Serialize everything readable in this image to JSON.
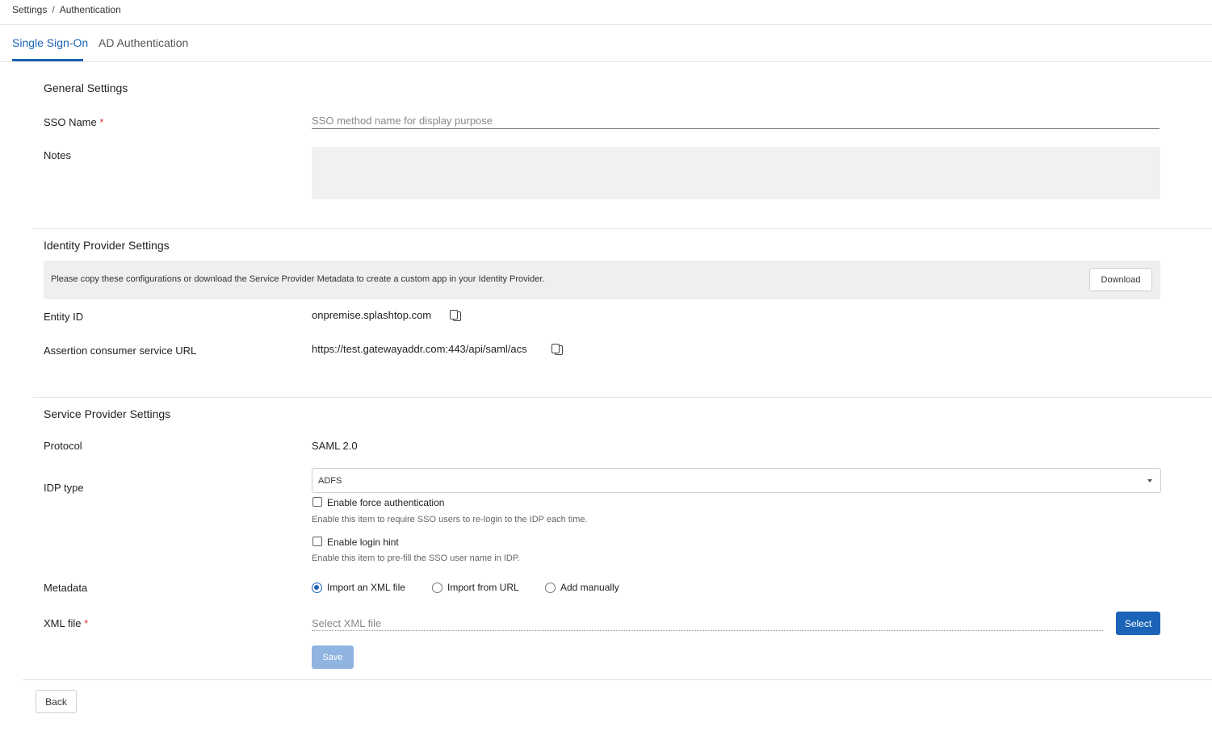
{
  "breadcrumb": {
    "parent": "Settings",
    "separator": "/",
    "current": "Authentication"
  },
  "tabs": [
    {
      "label": "Single Sign-On",
      "active": true
    },
    {
      "label": "AD Authentication",
      "active": false
    }
  ],
  "general": {
    "title": "General Settings",
    "sso_name_label": "SSO Name",
    "required_mark": "*",
    "sso_name_placeholder": "SSO method name for display purpose",
    "sso_name_value": "",
    "notes_label": "Notes",
    "notes_value": ""
  },
  "identity_provider": {
    "title": "Identity Provider Settings",
    "info_text": "Please copy these configurations or download the Service Provider Metadata to create a custom app in your Identity Provider.",
    "download_label": "Download",
    "entity_id_label": "Entity ID",
    "entity_id_value": "onpremise.splashtop.com",
    "acs_url_label": "Assertion consumer service URL",
    "acs_url_value": "https://test.gatewayaddr.com:443/api/saml/acs",
    "copy_icon": "copy-icon"
  },
  "service_provider": {
    "title": "Service Provider Settings",
    "protocol_label": "Protocol",
    "protocol_value": "SAML 2.0",
    "idp_type_label": "IDP type",
    "idp_type_value": "ADFS",
    "force_auth_label": "Enable force authentication",
    "force_auth_checked": false,
    "force_auth_hint": "Enable this item to require SSO users to re-login to the IDP each time.",
    "login_hint_label": "Enable login hint",
    "login_hint_checked": false,
    "login_hint_hint": "Enable this item to pre-fill the SSO user name in IDP.",
    "metadata_label": "Metadata",
    "metadata_options": [
      {
        "label": "Import an XML file",
        "selected": true
      },
      {
        "label": "Import from URL",
        "selected": false
      },
      {
        "label": "Add manually",
        "selected": false
      }
    ],
    "xml_file_label": "XML file",
    "xml_file_placeholder": "Select XML file",
    "select_label": "Select",
    "save_label": "Save"
  },
  "footer": {
    "back_label": "Back"
  },
  "colors": {
    "accent": "#1a63b7",
    "required": "#d9363e",
    "disabled_button": "#8fb4e0",
    "panel_bg": "#efefef"
  }
}
